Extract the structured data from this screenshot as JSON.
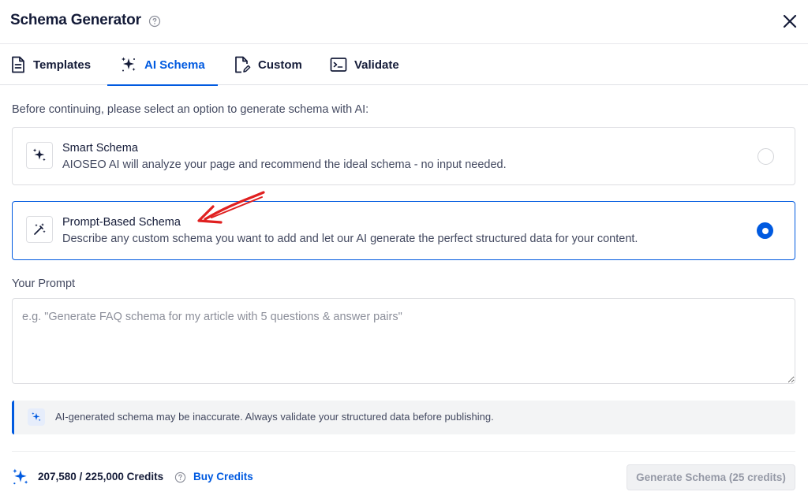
{
  "header": {
    "title": "Schema Generator",
    "help_icon": "question-circle-icon",
    "close_icon": "close-icon"
  },
  "tabs": [
    {
      "label": "Templates",
      "icon": "document-icon",
      "active": false
    },
    {
      "label": "AI Schema",
      "icon": "sparkles-icon",
      "active": true
    },
    {
      "label": "Custom",
      "icon": "file-edit-icon",
      "active": false
    },
    {
      "label": "Validate",
      "icon": "terminal-icon",
      "active": false
    }
  ],
  "intro_text": "Before continuing, please select an option to generate schema with AI:",
  "options": [
    {
      "title": "Smart Schema",
      "description": "AIOSEO AI will analyze your page and recommend the ideal schema - no input needed.",
      "icon": "sparkles-icon",
      "selected": false
    },
    {
      "title": "Prompt-Based Schema",
      "description": "Describe any custom schema you want to add and let our AI generate the perfect structured data for your content.",
      "icon": "magic-wand-icon",
      "selected": true
    }
  ],
  "prompt": {
    "label": "Your Prompt",
    "placeholder": "e.g. \"Generate FAQ schema for my article with 5 questions & answer pairs\"",
    "value": ""
  },
  "notice": {
    "text": "AI-generated schema may be inaccurate. Always validate your structured data before publishing.",
    "icon": "sparkles-icon"
  },
  "footer": {
    "credits_text": "207,580 / 225,000 Credits",
    "buy_credits_label": "Buy Credits",
    "generate_button_label": "Generate Schema (25 credits)",
    "generate_enabled": false
  },
  "colors": {
    "accent": "#005ae0",
    "text_primary": "#141b38",
    "text_secondary": "#434960",
    "border": "#dcdde1",
    "annotation": "#e02020"
  }
}
